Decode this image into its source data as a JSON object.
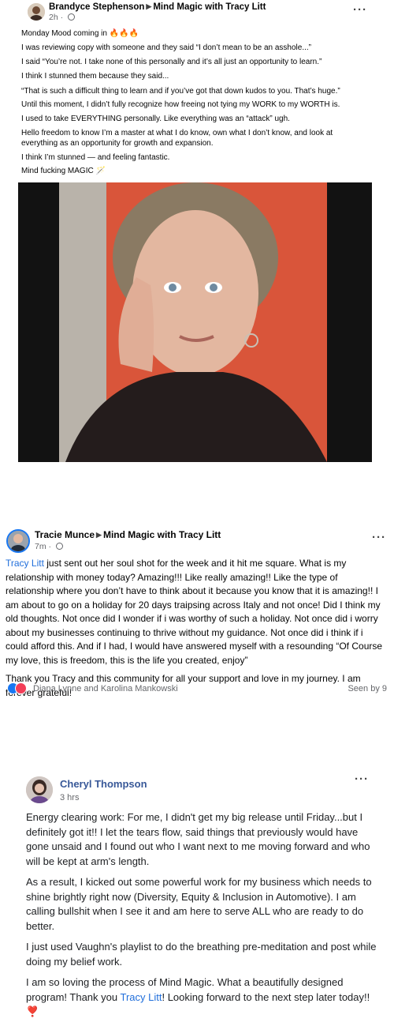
{
  "post1": {
    "author": "Brandyce Stephenson",
    "group": "Mind Magic with Tracy Litt",
    "time": "2h",
    "more": "···",
    "lines": [
      "Monday Mood coming in 🔥🔥🔥",
      "I was reviewing copy with someone and they said “I don’t mean to be an asshole...”",
      "I said “You’re not. I take none of this personally and it’s all just an opportunity to learn.”",
      "I think I stunned them because they said...",
      "“That is such a difficult thing to learn and if you’ve got that down kudos to you. That’s huge.”",
      "Until this moment, I didn’t fully recognize how freeing not tying my WORK to my WORTH is.",
      "I used to take EVERYTHING personally. Like everything was an “attack” ugh.",
      "Hello freedom to know I’m a master at what I do know, own what I don’t know, and look at",
      "everything as an opportunity for growth and expansion.",
      "I think I’m stunned — and feeling fantastic.",
      "Mind fucking MAGIC 🪄"
    ]
  },
  "post2": {
    "author": "Tracie Munce",
    "group": "Mind Magic with Tracy Litt",
    "time": "7m",
    "more": "···",
    "mention": "Tracy Litt",
    "text1": " just sent out her soul shot for the week and it hit me square. What is my relationship with money today? Amazing!!! Like really amazing!! Like the type of relationship where you don’t have to think about it because you know that it is amazing!! I am about to go on a holiday for 20 days traipsing across Italy and not once! Did I think my old thoughts. Not once did I wonder if i was worthy of such a holiday. Not once did i worry about my businesses continuing to thrive without my guidance. Not once did i think if i could afford this. And if I had, I would have answered myself with a resounding “Of Course my love, this is freedom, this is the life you created, enjoy”",
    "text2": "Thank you Tracy and this community for all your support and love in my journey. I am forever grateful!",
    "reactions": "Diana Lynne and Karolina Mankowski",
    "seen": "Seen by 9"
  },
  "post3": {
    "author": "Cheryl Thompson",
    "time": "3 hrs",
    "more": "···",
    "para1": "Energy clearing work: For me, I didn't get my big release until Friday...but I definitely got it!! I let the tears flow, said things that previously would have gone unsaid and I found out who I want next to me moving forward and who will be kept at arm's length.",
    "para2": "As a result, I kicked out some powerful work for my business which needs to shine brightly right now (Diversity, Equity & Inclusion in Automotive). I am calling bullshit when I see it and am here to serve ALL who are ready to do better.",
    "para3": "I just used Vaughn's playlist to do the breathing pre-meditation and post while doing my belief work.",
    "para4a": "I am so loving the process of Mind Magic. What a beautifully designed program! Thank you ",
    "mention": "Tracy Litt",
    "para4b": "! Looking forward to the next step later today!! ❣️"
  }
}
